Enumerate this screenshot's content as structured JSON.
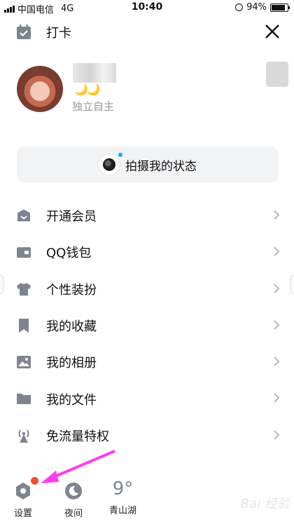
{
  "status_bar": {
    "carrier": "中国电信",
    "network": "4G",
    "time": "10:40",
    "battery": "94%",
    "battery_level": 0.94
  },
  "header": {
    "checkin_label": "打卡"
  },
  "profile": {
    "signature": "独立自主",
    "level_badges": "🌙🌙"
  },
  "status_button": {
    "label": "拍摄我的状态"
  },
  "menu": {
    "items": [
      {
        "label": "开通会员",
        "icon": "vip-house-icon"
      },
      {
        "label": "QQ钱包",
        "icon": "wallet-icon"
      },
      {
        "label": "个性装扮",
        "icon": "shirt-icon"
      },
      {
        "label": "我的收藏",
        "icon": "bookmark-icon"
      },
      {
        "label": "我的相册",
        "icon": "photo-icon"
      },
      {
        "label": "我的文件",
        "icon": "folder-icon"
      },
      {
        "label": "免流量特权",
        "icon": "signal-tower-icon"
      }
    ]
  },
  "bottom": {
    "settings_label": "设置",
    "night_label": "夜间",
    "weather_temp": "9°",
    "weather_city": "青山湖"
  },
  "colors": {
    "icon": "#7f8490",
    "accent_dot": "#1aa3ff",
    "arrow": "#ff3cf0",
    "badge": "#f04f2d"
  },
  "watermark": "Bai 经验"
}
